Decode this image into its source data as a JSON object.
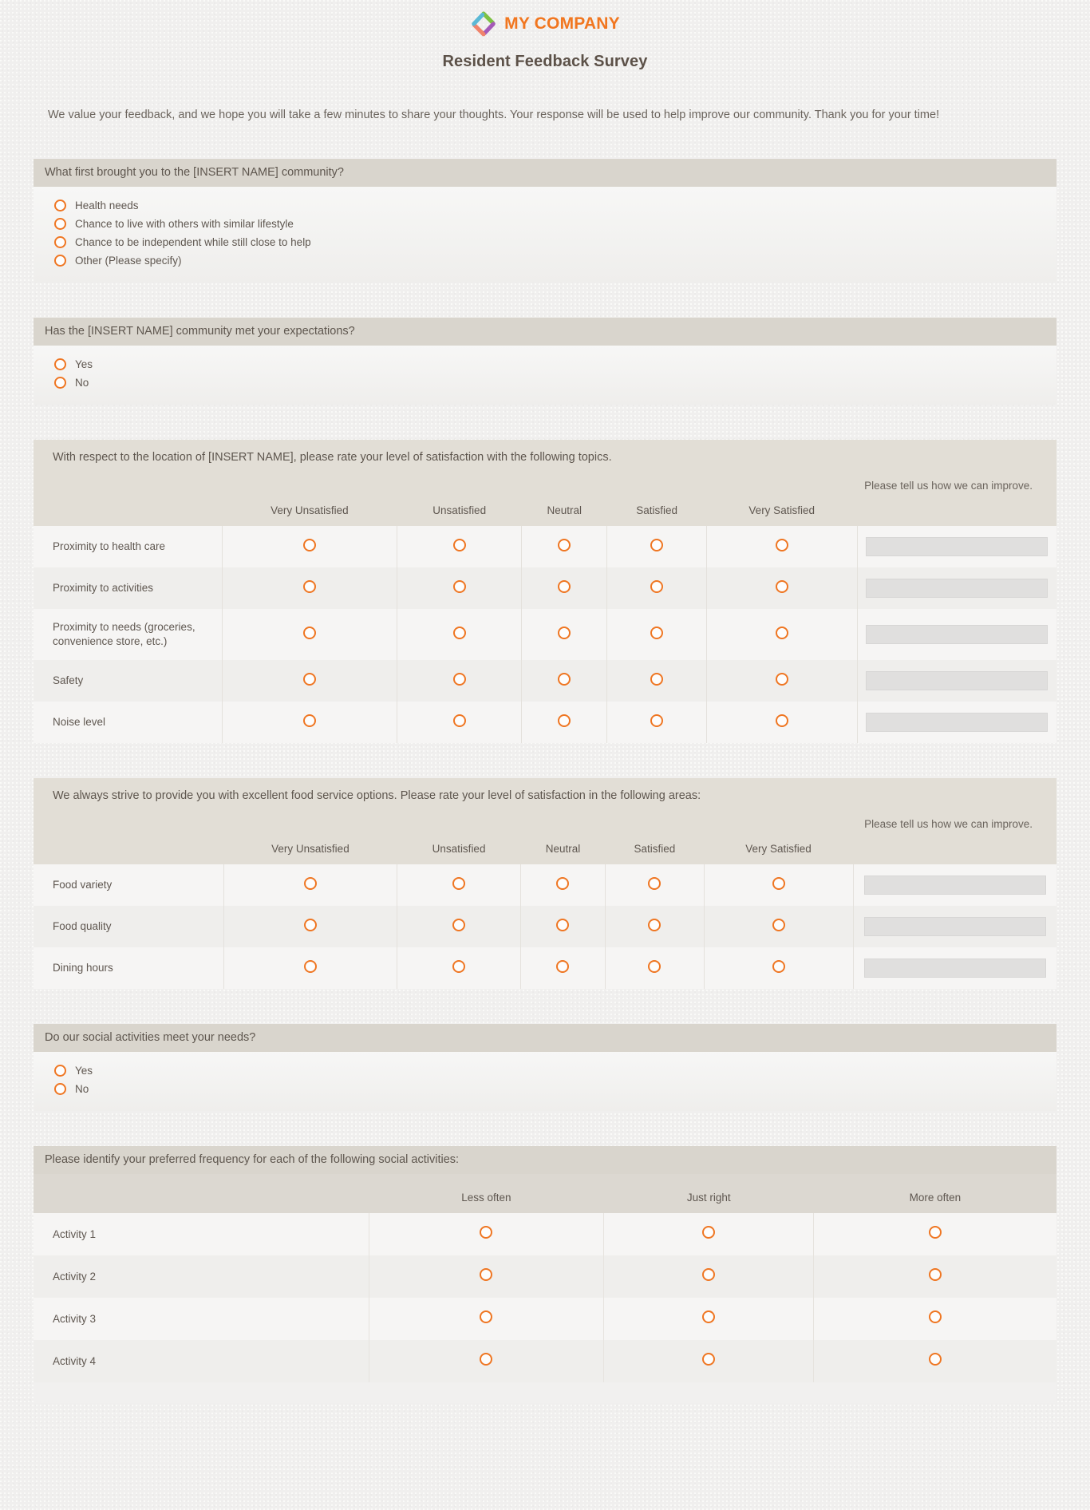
{
  "brand": {
    "name": "MY COMPANY",
    "logo_icon": "diamond-logo-icon",
    "accent_color": "#f1761f",
    "logo_colors": [
      "#7dc242",
      "#a55ab8",
      "#f0836b",
      "#5bb9d6"
    ]
  },
  "title": "Resident Feedback Survey",
  "intro": "We value your feedback, and we hope you will take a few minutes to share your thoughts. Your response will be used to help improve our community. Thank you for your time!",
  "q1": {
    "header": "What first brought you to the [INSERT NAME] community?",
    "options": [
      "Health needs",
      "Chance to live with others with similar lifestyle",
      "Chance to be independent while still close to help",
      "Other (Please specify)"
    ]
  },
  "q2": {
    "header": "Has the [INSERT NAME] community met your expectations?",
    "options": [
      "Yes",
      "No"
    ]
  },
  "q3": {
    "header": "With respect to the location of [INSERT NAME],  please rate your level of satisfaction with the following topics.",
    "improve_header": "Please tell us how we can improve.",
    "columns": [
      "Very Unsatisfied",
      "Unsatisfied",
      "Neutral",
      "Satisfied",
      "Very Satisfied"
    ],
    "rows": [
      "Proximity to health care",
      "Proximity to activities",
      "Proximity to needs (groceries, convenience store, etc.)",
      "Safety",
      "Noise level"
    ],
    "input_values": [
      "",
      "",
      "",
      "",
      ""
    ]
  },
  "q4": {
    "header": "We always strive to provide you with excellent food service options. Please rate your level of satisfaction in the following areas:",
    "improve_header": "Please tell us how we can improve.",
    "columns": [
      "Very Unsatisfied",
      "Unsatisfied",
      "Neutral",
      "Satisfied",
      "Very Satisfied"
    ],
    "rows": [
      "Food variety",
      "Food quality",
      "Dining hours"
    ],
    "input_values": [
      "",
      "",
      ""
    ]
  },
  "q5": {
    "header": "Do our social activities meet your needs?",
    "options": [
      "Yes",
      "No"
    ]
  },
  "q6": {
    "header": "Please identify your preferred frequency for each of the following social activities:",
    "columns": [
      "Less often",
      "Just right",
      "More often"
    ],
    "rows": [
      "Activity 1",
      "Activity 2",
      "Activity 3",
      "Activity 4"
    ]
  }
}
